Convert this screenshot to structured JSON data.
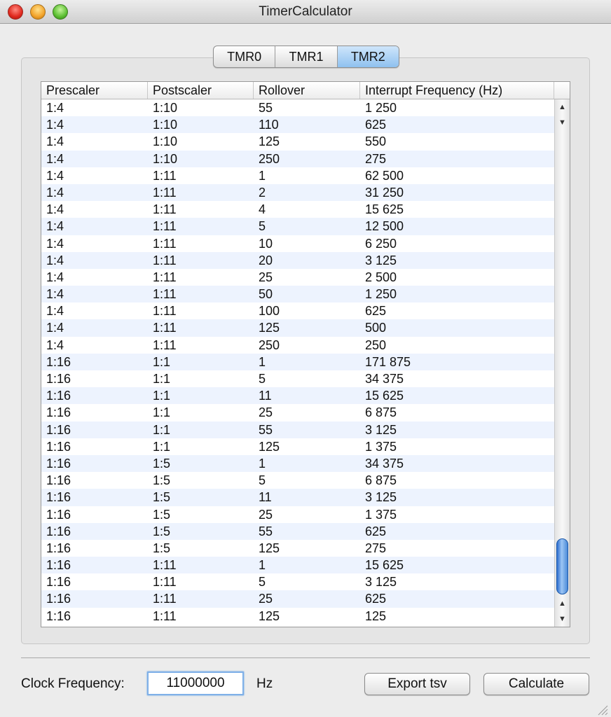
{
  "window": {
    "title": "TimerCalculator"
  },
  "tabs": [
    {
      "label": "TMR0",
      "active": false
    },
    {
      "label": "TMR1",
      "active": false
    },
    {
      "label": "TMR2",
      "active": true
    }
  ],
  "table": {
    "columns": [
      "Prescaler",
      "Postscaler",
      "Rollover",
      "Interrupt Frequency (Hz)"
    ],
    "rows": [
      [
        "1:4",
        "1:10",
        "55",
        "1 250"
      ],
      [
        "1:4",
        "1:10",
        "110",
        "625"
      ],
      [
        "1:4",
        "1:10",
        "125",
        "550"
      ],
      [
        "1:4",
        "1:10",
        "250",
        "275"
      ],
      [
        "1:4",
        "1:11",
        "1",
        "62 500"
      ],
      [
        "1:4",
        "1:11",
        "2",
        "31 250"
      ],
      [
        "1:4",
        "1:11",
        "4",
        "15 625"
      ],
      [
        "1:4",
        "1:11",
        "5",
        "12 500"
      ],
      [
        "1:4",
        "1:11",
        "10",
        "6 250"
      ],
      [
        "1:4",
        "1:11",
        "20",
        "3 125"
      ],
      [
        "1:4",
        "1:11",
        "25",
        "2 500"
      ],
      [
        "1:4",
        "1:11",
        "50",
        "1 250"
      ],
      [
        "1:4",
        "1:11",
        "100",
        "625"
      ],
      [
        "1:4",
        "1:11",
        "125",
        "500"
      ],
      [
        "1:4",
        "1:11",
        "250",
        "250"
      ],
      [
        "1:16",
        "1:1",
        "1",
        "171 875"
      ],
      [
        "1:16",
        "1:1",
        "5",
        "34 375"
      ],
      [
        "1:16",
        "1:1",
        "11",
        "15 625"
      ],
      [
        "1:16",
        "1:1",
        "25",
        "6 875"
      ],
      [
        "1:16",
        "1:1",
        "55",
        "3 125"
      ],
      [
        "1:16",
        "1:1",
        "125",
        "1 375"
      ],
      [
        "1:16",
        "1:5",
        "1",
        "34 375"
      ],
      [
        "1:16",
        "1:5",
        "5",
        "6 875"
      ],
      [
        "1:16",
        "1:5",
        "11",
        "3 125"
      ],
      [
        "1:16",
        "1:5",
        "25",
        "1 375"
      ],
      [
        "1:16",
        "1:5",
        "55",
        "625"
      ],
      [
        "1:16",
        "1:5",
        "125",
        "275"
      ],
      [
        "1:16",
        "1:11",
        "1",
        "15 625"
      ],
      [
        "1:16",
        "1:11",
        "5",
        "3 125"
      ],
      [
        "1:16",
        "1:11",
        "25",
        "625"
      ],
      [
        "1:16",
        "1:11",
        "125",
        "125"
      ]
    ]
  },
  "footer": {
    "clock_label": "Clock Frequency:",
    "clock_value": "11000000",
    "unit": "Hz",
    "export_label": "Export tsv",
    "calculate_label": "Calculate"
  },
  "colors": {
    "active_tab": "#8fc1ef",
    "row_stripe": "#edf3fe",
    "scroll_thumb": "#2f6fcf"
  }
}
